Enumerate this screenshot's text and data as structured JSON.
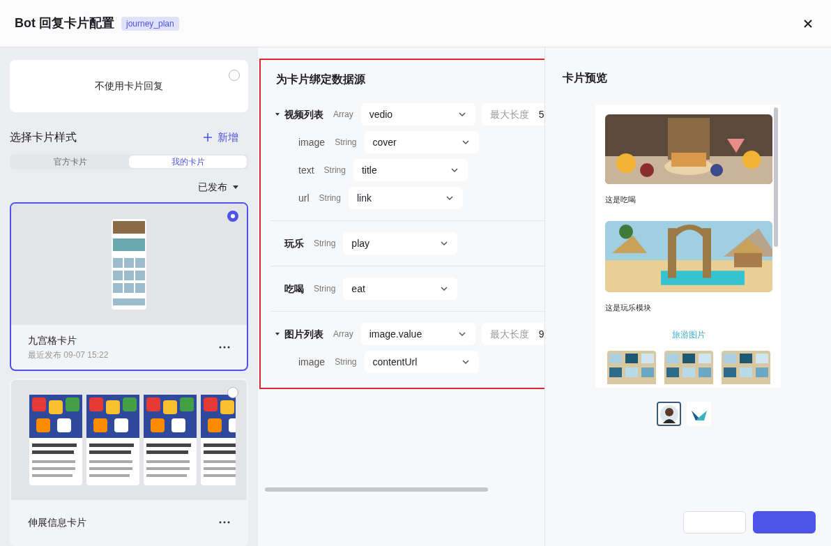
{
  "header": {
    "title": "Bot 回复卡片配置",
    "tag": "journey_plan"
  },
  "no_card_option": {
    "label": "不使用卡片回复",
    "selected": false
  },
  "card_styles": {
    "title": "选择卡片样式",
    "add_label": "新增"
  },
  "tabs": [
    {
      "label": "官方卡片",
      "selected": false
    },
    {
      "label": "我的卡片",
      "selected": true
    }
  ],
  "filter": {
    "label": "已发布"
  },
  "cards": [
    {
      "kind": "grid",
      "name": "九宫格卡片",
      "subtitle": "最近发布 09-07 15:22",
      "selected": true
    },
    {
      "kind": "strip",
      "name": "伸展信息卡片",
      "selected": false
    }
  ],
  "binding": {
    "title": "为卡片绑定数据源",
    "groups": [
      {
        "name": "视频列表",
        "type": "Array",
        "value": "vedio",
        "expanded": true,
        "max_length": {
          "label": "最大长度",
          "value": "5"
        },
        "children": [
          {
            "name": "image",
            "type": "String",
            "value": "cover"
          },
          {
            "name": "text",
            "type": "String",
            "value": "title"
          },
          {
            "name": "url",
            "type": "String",
            "value": "link"
          }
        ]
      },
      {
        "name": "玩乐",
        "type": "String",
        "value": "play"
      },
      {
        "name": "吃喝",
        "type": "String",
        "value": "eat"
      },
      {
        "name": "图片列表",
        "type": "Array",
        "value": "image.value",
        "expanded": true,
        "max_length": {
          "label": "最大长度",
          "value": "9"
        },
        "children": [
          {
            "name": "image",
            "type": "String",
            "value": "contentUrl"
          }
        ]
      }
    ]
  },
  "preview": {
    "title": "卡片预览",
    "sections": [
      {
        "kind": "food",
        "caption": "这是吃喝"
      },
      {
        "kind": "beach",
        "caption": "这是玩乐模块"
      }
    ],
    "gallery_title": "旅游图片",
    "avatars": [
      {
        "kind": "person",
        "selected": true
      },
      {
        "kind": "logo",
        "selected": false
      }
    ]
  },
  "footer_buttons": [
    {
      "kind": "secondary"
    },
    {
      "kind": "primary"
    }
  ]
}
